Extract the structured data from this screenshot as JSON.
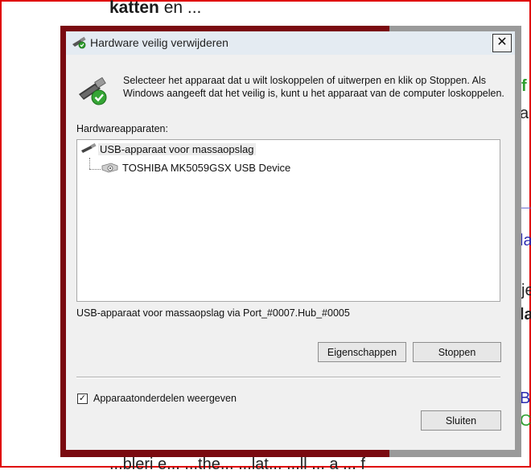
{
  "background": {
    "heading_bold": "katten",
    "heading_rest": " en ...",
    "right_fragments": [
      "f",
      "a",
      "la",
      "je",
      "la",
      "B",
      "C"
    ],
    "bottom_text": "...bleri e... ...the... ...lat... ...ll ... a ... f"
  },
  "dialog": {
    "title": "Hardware veilig verwijderen",
    "close_label": "✕",
    "description": "Selecteer het apparaat dat u wilt loskoppelen of uitwerpen en klik op Stoppen. Als Windows aangeeft dat het veilig is, kunt u het apparaat van de computer loskoppelen.",
    "devices_label": "Hardwareapparaten:",
    "tree": {
      "root": "USB-apparaat voor massaopslag",
      "child": "TOSHIBA MK5059GSX USB Device"
    },
    "location_text": "USB-apparaat voor massaopslag via Port_#0007.Hub_#0005",
    "properties_button": "Eigenschappen",
    "stop_button": "Stoppen",
    "checkbox_label": "Apparaatonderdelen weergeven",
    "checkbox_checked": true,
    "close_button": "Sluiten"
  },
  "colors": {
    "accent_green": "#2e9e2e",
    "link_blue": "#2a2ab0",
    "window_border": "#7a0a10"
  },
  "icons": {
    "title": "usb-safely-remove-icon",
    "device_root": "usb-device-icon",
    "device_child": "disk-drive-icon"
  }
}
